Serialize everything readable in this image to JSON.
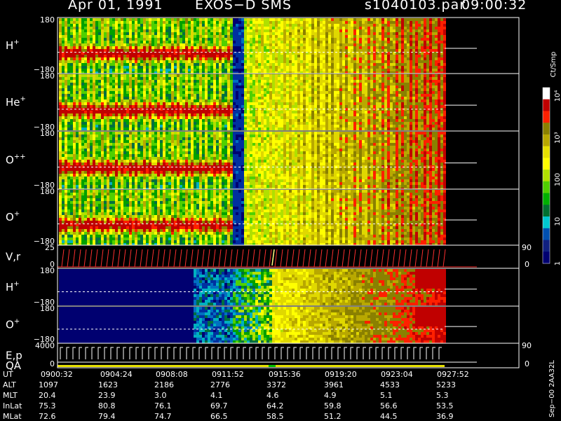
{
  "header": {
    "date": "Apr 01, 1991",
    "instrument": "EXOS−D SMS",
    "file": "s1040103.par",
    "time": "09:00:32"
  },
  "side_text": "Sep−00  2AA32L",
  "chart_data": [
    {
      "type": "heatmap",
      "panels": [
        {
          "name": "H+",
          "label": "H",
          "sup": "+",
          "ytop": "180",
          "ybot": "−180",
          "yrange": [
            -180,
            180
          ]
        },
        {
          "name": "He+",
          "label": "He",
          "sup": "+",
          "ytop": "180",
          "ybot": "−180",
          "yrange": [
            -180,
            180
          ]
        },
        {
          "name": "O++",
          "label": "O",
          "sup": "++",
          "ytop": "180",
          "ybot": "−180",
          "yrange": [
            -180,
            180
          ]
        },
        {
          "name": "O+",
          "label": "O",
          "sup": "+",
          "ytop": "180",
          "ybot": "−180",
          "yrange": [
            -180,
            180
          ]
        },
        {
          "name": "V,r",
          "label": "V,r",
          "sup": "",
          "ytop": "25",
          "ybot": "0",
          "right": "90",
          "right_bottom": "0"
        },
        {
          "name": "H+ (2)",
          "label": "H",
          "sup": "+",
          "ytop": "180",
          "ybot": "−180",
          "yrange": [
            -180,
            180
          ]
        },
        {
          "name": "O+ (2)",
          "label": "O",
          "sup": "+",
          "ytop": "180",
          "ybot": "−180",
          "yrange": [
            -180,
            180
          ]
        },
        {
          "name": "E,p QA",
          "label": "E,p",
          "label2": "QA",
          "sup": "",
          "ytop": "4000",
          "ybot": "0",
          "right": "90",
          "right_bottom": "0"
        }
      ],
      "colorbar": {
        "label": "Ct/Smp",
        "tick_labels": [
          "10⁴",
          "10³",
          "100",
          "10",
          "1"
        ],
        "tick_values": [
          10000,
          1000,
          100,
          10,
          1
        ],
        "scale": "log",
        "colors": [
          "#ffffff",
          "#c00000",
          "#ff2000",
          "#8a8000",
          "#b8a800",
          "#e6e000",
          "#ffff00",
          "#b0e000",
          "#50d000",
          "#00b000",
          "#007030",
          "#00c8d0",
          "#0050b0",
          "#102080",
          "#000070"
        ]
      }
    }
  ],
  "table": {
    "rows": [
      {
        "label": "UT",
        "values": [
          "0900:32",
          "0904:24",
          "0908:08",
          "0911:52",
          "0915:36",
          "0919:20",
          "0923:04",
          "0927:52"
        ]
      },
      {
        "label": "ALT",
        "values": [
          "1097",
          "1623",
          "2186",
          "2776",
          "3372",
          "3961",
          "4533",
          "5233"
        ]
      },
      {
        "label": "MLT",
        "values": [
          "20.4",
          "23.9",
          "3.0",
          "4.1",
          "4.6",
          "4.9",
          "5.1",
          "5.3"
        ]
      },
      {
        "label": "InLat",
        "values": [
          "75.3",
          "80.8",
          "76.1",
          "69.7",
          "64.2",
          "59.8",
          "56.6",
          "53.5"
        ]
      },
      {
        "label": "MLat",
        "values": [
          "72.6",
          "79.4",
          "74.7",
          "66.5",
          "58.5",
          "51.2",
          "44.5",
          "36.9"
        ]
      }
    ]
  }
}
